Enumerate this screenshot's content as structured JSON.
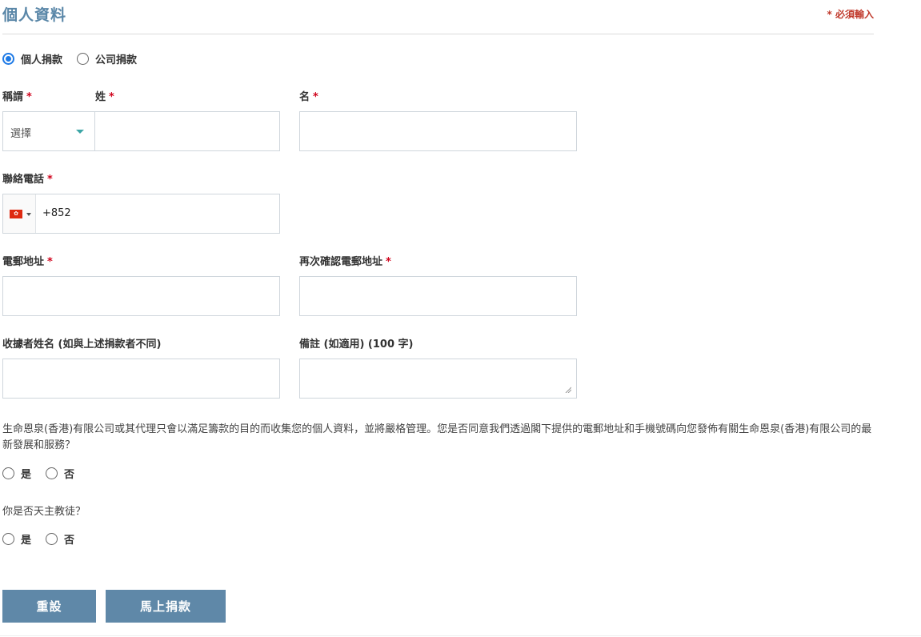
{
  "header": {
    "title": "個人資料",
    "required_note": "* 必須輸入"
  },
  "donor_type": {
    "options": [
      {
        "label": "個人捐款",
        "checked": true
      },
      {
        "label": "公司捐款",
        "checked": false
      }
    ]
  },
  "fields": {
    "title_label": "稱謂",
    "title_select_value": "選擇",
    "surname_label": "姓",
    "given_name_label": "名",
    "phone_label": "聯絡電話",
    "phone_flag": "🇭🇰",
    "phone_code": "+852",
    "email_label": "電郵地址",
    "email_confirm_label": "再次確認電郵地址",
    "receipt_name_label": "收據者姓名 (如與上述捐款者不同)",
    "remarks_label": "備註 (如適用) (100 字)",
    "required_star": "*"
  },
  "consent": {
    "question": "生命恩泉(香港)有限公司或其代理只會以滿足籌款的目的而收集您的個人資料，並將嚴格管理。您是否同意我們透過閣下提供的電郵地址和手機號碼向您發佈有關生命恩泉(香港)有限公司的最新發展和服務？",
    "yes": "是",
    "no": "否"
  },
  "catholic": {
    "question": "你是否天主教徒？",
    "yes": "是",
    "no": "否"
  },
  "buttons": {
    "reset": "重設",
    "donate": "馬上捐款"
  },
  "colors": {
    "accent": "#5f88a8",
    "required": "#d0021b",
    "radio_active": "#1e7ae6"
  }
}
